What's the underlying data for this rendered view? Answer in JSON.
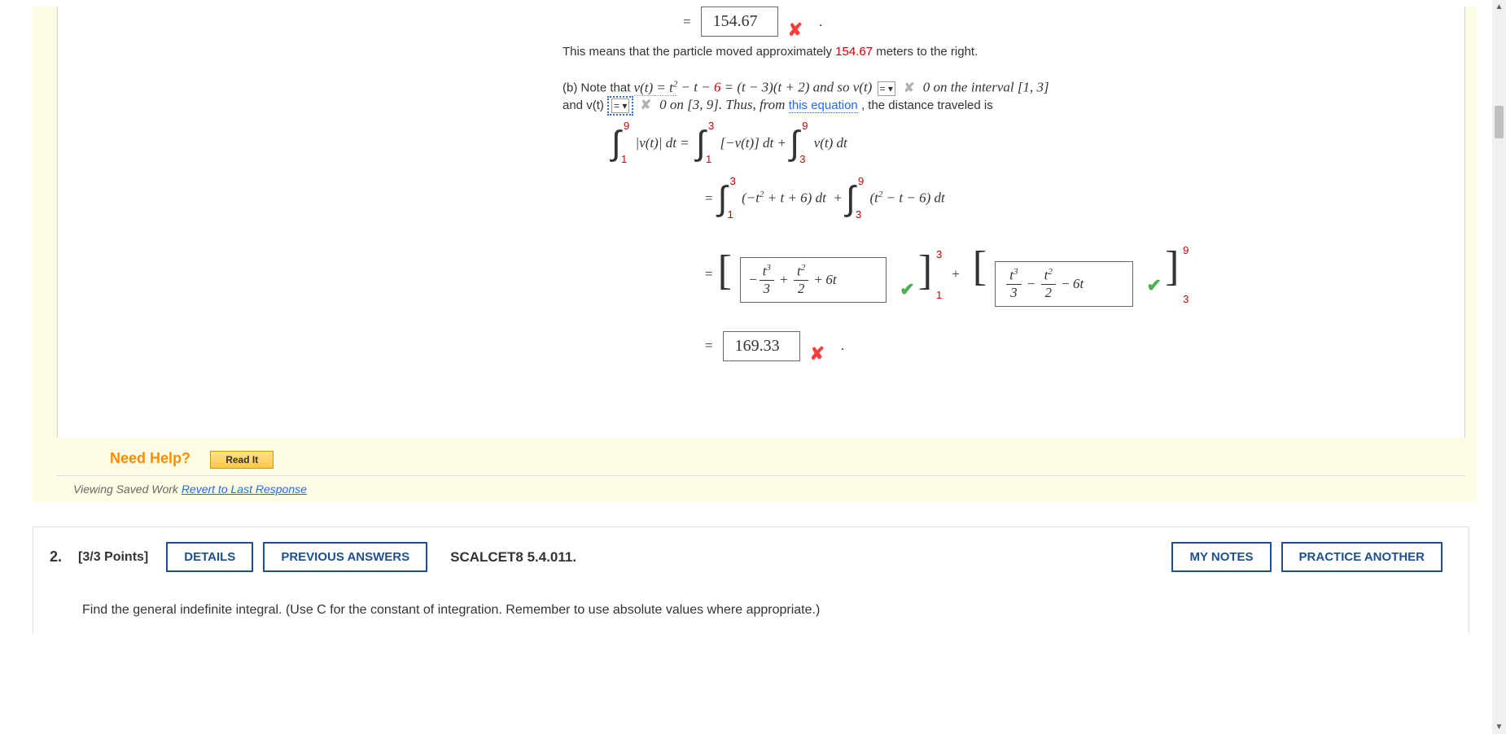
{
  "q1": {
    "ans1": {
      "equals": "=",
      "value": "154.67"
    },
    "explain_pre": "This means that the particle moved approximately ",
    "explain_num": "154.67",
    "explain_post": " meters to the right.",
    "partb": {
      "pre": "(b) Note that  ",
      "vt": "v(t) = t",
      "sq": "2",
      "mid1": " − t − ",
      "six": "6",
      "factored": " = (t − 3)(t + 2)  and so  v(t) ",
      "dd1_selected": "=",
      "zero_interval": "   0  on the interval  [1, 3]",
      "line2_pre": "and  v(t) ",
      "dd2_selected": "=",
      "line2_mid": "   0  on  [3, 9]. Thus, from ",
      "link": "this equation",
      "line2_post": ", the distance traveled is"
    },
    "int_row": {
      "ub1": "9",
      "lb1": "1",
      "abs_vt": "|v(t)| dt  =",
      "ub2": "3",
      "lb2": "1",
      "neg_vt": "[−v(t)] dt  +",
      "ub3": "9",
      "lb3": "3",
      "vt": "v(t) dt"
    },
    "int_row2": {
      "eq": "=",
      "ub1": "3",
      "lb1": "1",
      "expr1": "(−t² + t + 6) dt  +",
      "ub2": "9",
      "lb2": "3",
      "expr2": "(t² − t − 6) dt"
    },
    "eval_row": {
      "eq": "=",
      "box1_expr": "− t³/3 + t²/2 + 6t",
      "box1_raw_num1": "t",
      "box1_raw_p1": "3",
      "box1_raw_den1": "3",
      "box1_raw_num2": "t",
      "box1_raw_p2": "2",
      "box1_raw_den2": "2",
      "box1_raw_last": "6t",
      "ub1": "3",
      "lb1": "1",
      "plus": "+",
      "box2_raw_num1": "t",
      "box2_raw_p1": "3",
      "box2_raw_den1": "3",
      "box2_raw_num2": "t",
      "box2_raw_p2": "2",
      "box2_raw_den2": "2",
      "box2_raw_last": "6t",
      "ub2": "9",
      "lb2": "3"
    },
    "ans2": {
      "equals": "=",
      "value": "169.33"
    },
    "need_help": "Need Help?",
    "read_it": "Read It",
    "saved_work": "Viewing Saved Work ",
    "revert": "Revert to Last Response"
  },
  "q2": {
    "num": "2.",
    "points": "[3/3 Points]",
    "details": "DETAILS",
    "prev": "PREVIOUS ANSWERS",
    "ref": "SCALCET8 5.4.011.",
    "mynotes": "MY NOTES",
    "practice": "PRACTICE ANOTHER",
    "prompt": "Find the general indefinite integral. (Use C for the constant of integration. Remember to use absolute values where appropriate.)"
  }
}
